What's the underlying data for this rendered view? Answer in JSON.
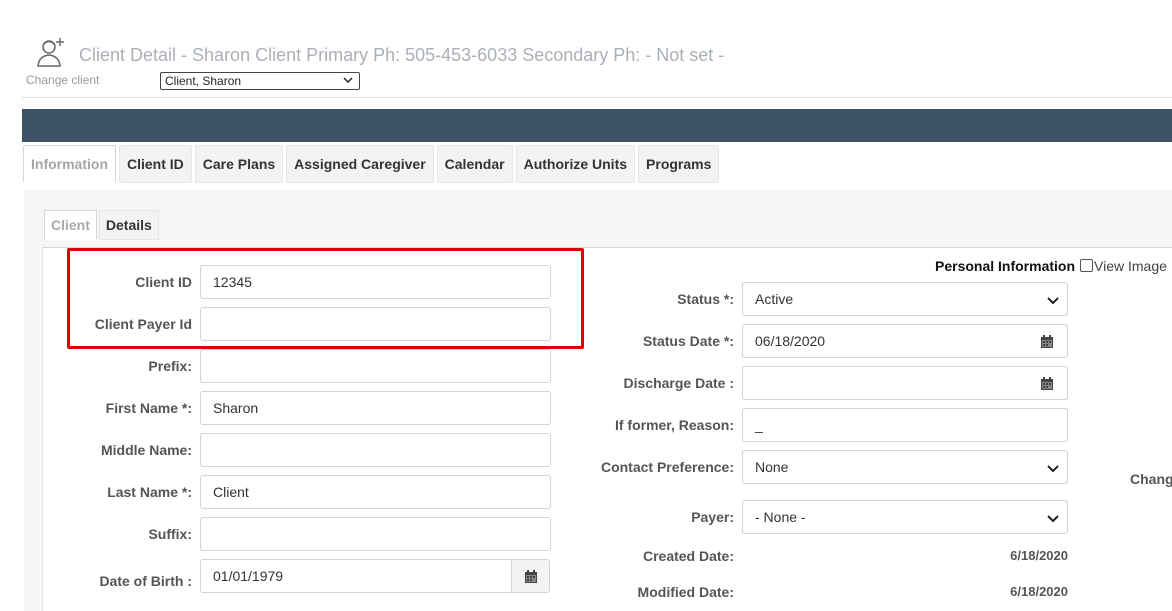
{
  "header": {
    "title": "Client Detail - Sharon Client Primary Ph: 505-453-6033 Secondary Ph: - Not set -",
    "change_client_label": "Change client",
    "client_select_value": "Client, Sharon",
    "icon": "user-add-icon"
  },
  "tabs": [
    "Information",
    "Client ID",
    "Care Plans",
    "Assigned Caregiver",
    "Calendar",
    "Authorize Units",
    "Programs"
  ],
  "active_tab": "Information",
  "subtabs": [
    "Client",
    "Details"
  ],
  "active_subtab": "Client",
  "left_form": {
    "client_id_label": "Client ID",
    "client_id_value": "12345",
    "client_payer_id_label": "Client Payer Id",
    "client_payer_id_value": "",
    "prefix_label": "Prefix:",
    "prefix_value": "",
    "first_name_label": "First Name *:",
    "first_name_value": "Sharon",
    "middle_name_label": "Middle Name:",
    "middle_name_value": "",
    "last_name_label": "Last Name *:",
    "last_name_value": "Client",
    "suffix_label": "Suffix:",
    "suffix_value": "",
    "dob_label": "Date of Birth :",
    "dob_value": "01/01/1979"
  },
  "right_form": {
    "section_title": "Personal Information",
    "view_image_label": "View Image",
    "status_label": "Status *:",
    "status_value": "Active",
    "status_date_label": "Status Date *:",
    "status_date_value": "06/18/2020",
    "discharge_date_label": "Discharge Date :",
    "discharge_date_value": "",
    "if_former_label": "If former, Reason:",
    "if_former_value": "_",
    "contact_pref_label": "Contact Preference:",
    "contact_pref_value": "None",
    "payer_label": "Payer:",
    "payer_value": "- None -",
    "created_date_label": "Created Date:",
    "created_date_value": "6/18/2020",
    "modified_date_label": "Modified Date:",
    "modified_date_value": "6/18/2020",
    "change_text": "Chang"
  },
  "colors": {
    "dark_bar": "#3e5368",
    "highlight": "#e00000"
  }
}
